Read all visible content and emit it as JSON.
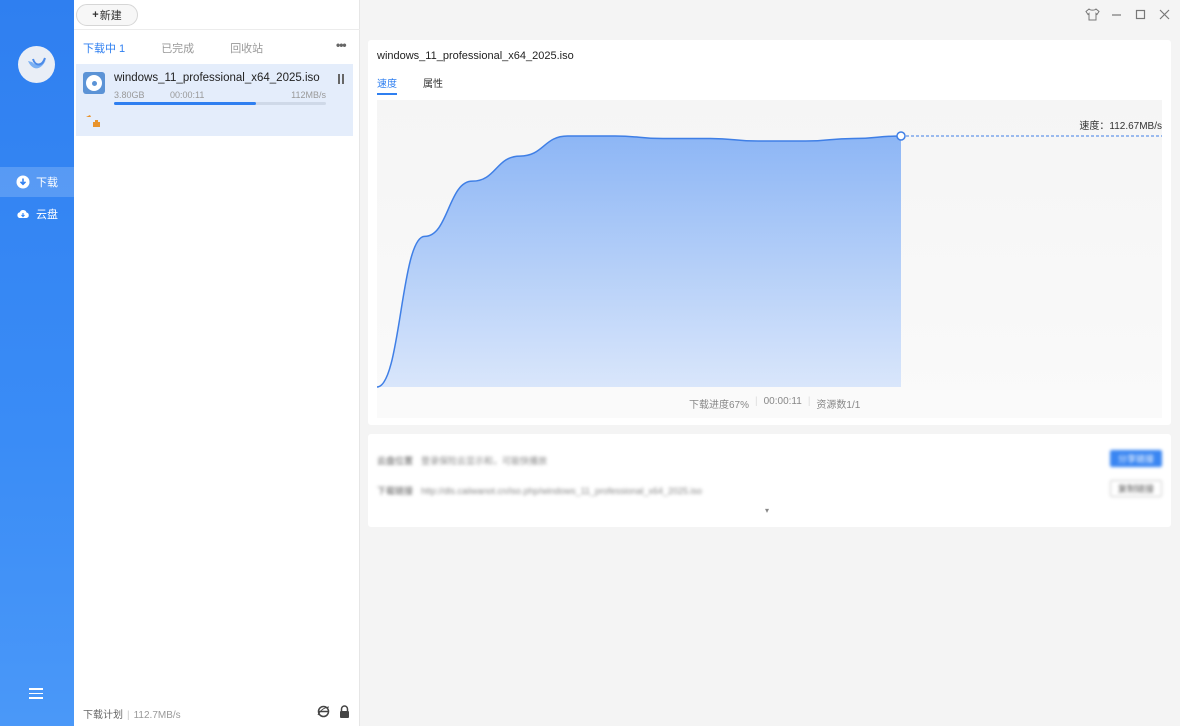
{
  "nav": {
    "items": [
      {
        "label": "下载",
        "icon": "download-icon"
      },
      {
        "label": "云盘",
        "icon": "cloud-icon"
      }
    ]
  },
  "toolbar": {
    "new_label": "新建"
  },
  "list": {
    "tabs": [
      "下载中 1",
      "已完成",
      "回收站"
    ],
    "task": {
      "name": "windows_11_professional_x64_2025.iso",
      "size": "3.80GB",
      "time": "00:00:11",
      "speed": "112MB/s",
      "progress": 0.67
    },
    "footer": {
      "plan_label": "下载计划",
      "rate": "112.7MB/s"
    }
  },
  "detail": {
    "title": "windows_11_professional_x64_2025.iso",
    "tabs": [
      "速度",
      "属性"
    ],
    "speed_label": "速度：112.67MB/s",
    "stats": {
      "progress": "下载进度67%",
      "time": "00:00:11",
      "sources": "资源数1/1"
    }
  },
  "info": {
    "row1_key": "云盘位置",
    "row1_val": "登录保险云显示和，可能快播放",
    "row2_key": "下载链接",
    "row2_val": "http://dls.caiiwanot.cn/iso.php/windows_11_professional_x64_2025.iso",
    "share_label": "分享链接",
    "copy_label": "复制链接"
  },
  "chart_data": {
    "type": "area",
    "title": "",
    "xlabel": "",
    "ylabel": "",
    "x": [
      0,
      1,
      2,
      3,
      4,
      5,
      6,
      7,
      8,
      9,
      10,
      11
    ],
    "series": [
      {
        "values": [
          0,
          60,
          82,
          92,
          100,
          100,
          99,
          99,
          98,
          98,
          99,
          100
        ]
      }
    ],
    "current_value": "112.67MB/s",
    "colors": {
      "fill": "#9cc0f7",
      "line": "#3f7fe6"
    }
  }
}
